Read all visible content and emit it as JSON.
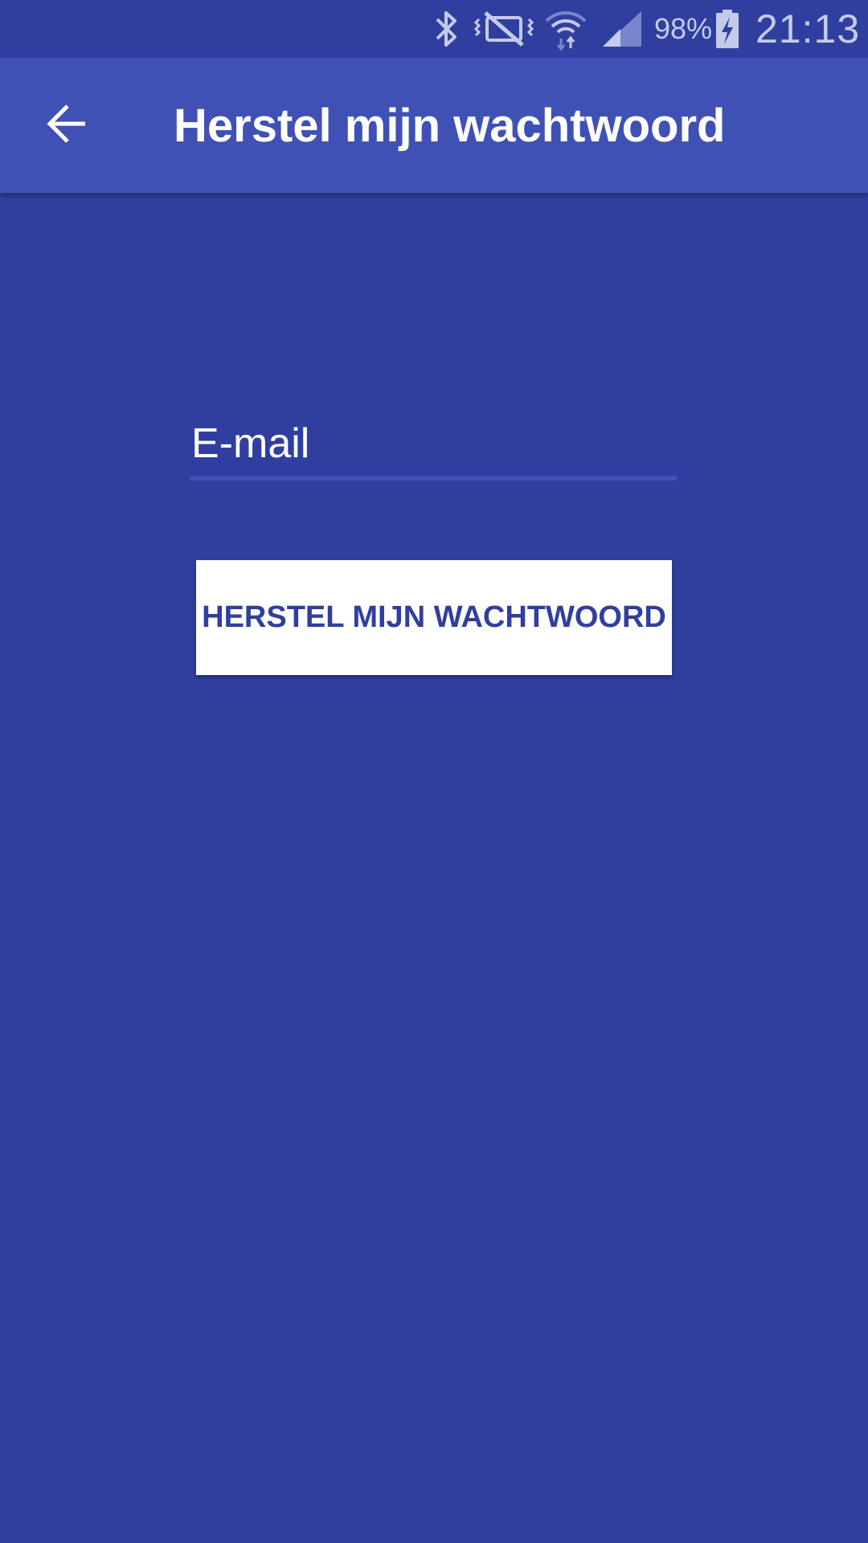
{
  "status_bar": {
    "battery_percent": "98%",
    "time": "21:13",
    "icons": [
      "bluetooth-icon",
      "vibrate-mute-icon",
      "wifi-icon",
      "signal-icon",
      "battery-charging-icon"
    ]
  },
  "app_bar": {
    "title": "Herstel mijn wachtwoord",
    "back_icon": "arrow-back-icon"
  },
  "form": {
    "email_placeholder": "E-mail",
    "email_value": "",
    "reset_button_label": "HERSTEL MIJN WACHTWOORD"
  },
  "colors": {
    "background": "#303F9F",
    "app_bar": "#3F51B5",
    "button_background": "#FFFFFF",
    "button_text": "#303F9F",
    "status_text": "#C5CAE9"
  }
}
